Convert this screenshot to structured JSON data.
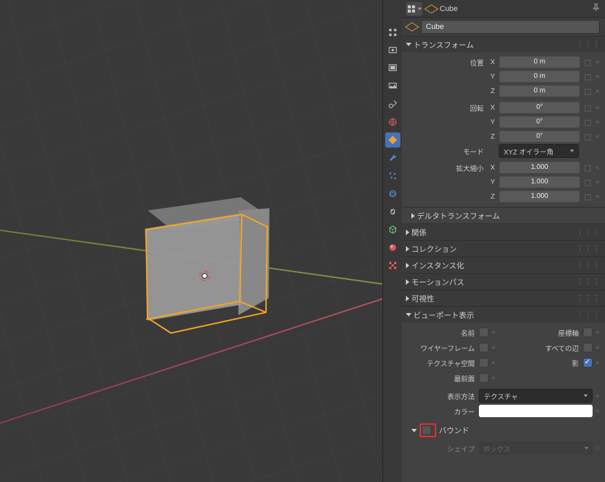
{
  "header": {
    "object_name": "Cube",
    "name_field": "Cube"
  },
  "sections": {
    "transform": "トランスフォーム",
    "delta": "デルタトランスフォーム",
    "relations": "関係",
    "collections": "コレクション",
    "instancing": "インスタンス化",
    "motion_paths": "モーションパス",
    "visibility": "可視性",
    "viewport_display": "ビューポート表示",
    "bounds": "バウンド"
  },
  "transform": {
    "location_label": "位置",
    "rotation_label": "回転",
    "scale_label": "拡大縮小",
    "mode_label": "モード",
    "mode_value": "XYZ オイラー角",
    "loc": {
      "x": "0 m",
      "y": "0 m",
      "z": "0 m"
    },
    "rot": {
      "x": "0°",
      "y": "0°",
      "z": "0°"
    },
    "scale": {
      "x": "1.000",
      "y": "1.000",
      "z": "1.000"
    }
  },
  "axes": {
    "x": "X",
    "y": "Y",
    "z": "Z"
  },
  "display": {
    "name": "名前",
    "axis": "座標軸",
    "wireframe": "ワイヤーフレーム",
    "all_edges": "すべての辺",
    "texture_space": "テクスチャ空間",
    "shadow": "影",
    "in_front": "最前面",
    "display_as": "表示方法",
    "display_as_value": "テクスチャ",
    "color": "カラー",
    "shape": "シェイプ",
    "shape_value": "ボックス"
  }
}
